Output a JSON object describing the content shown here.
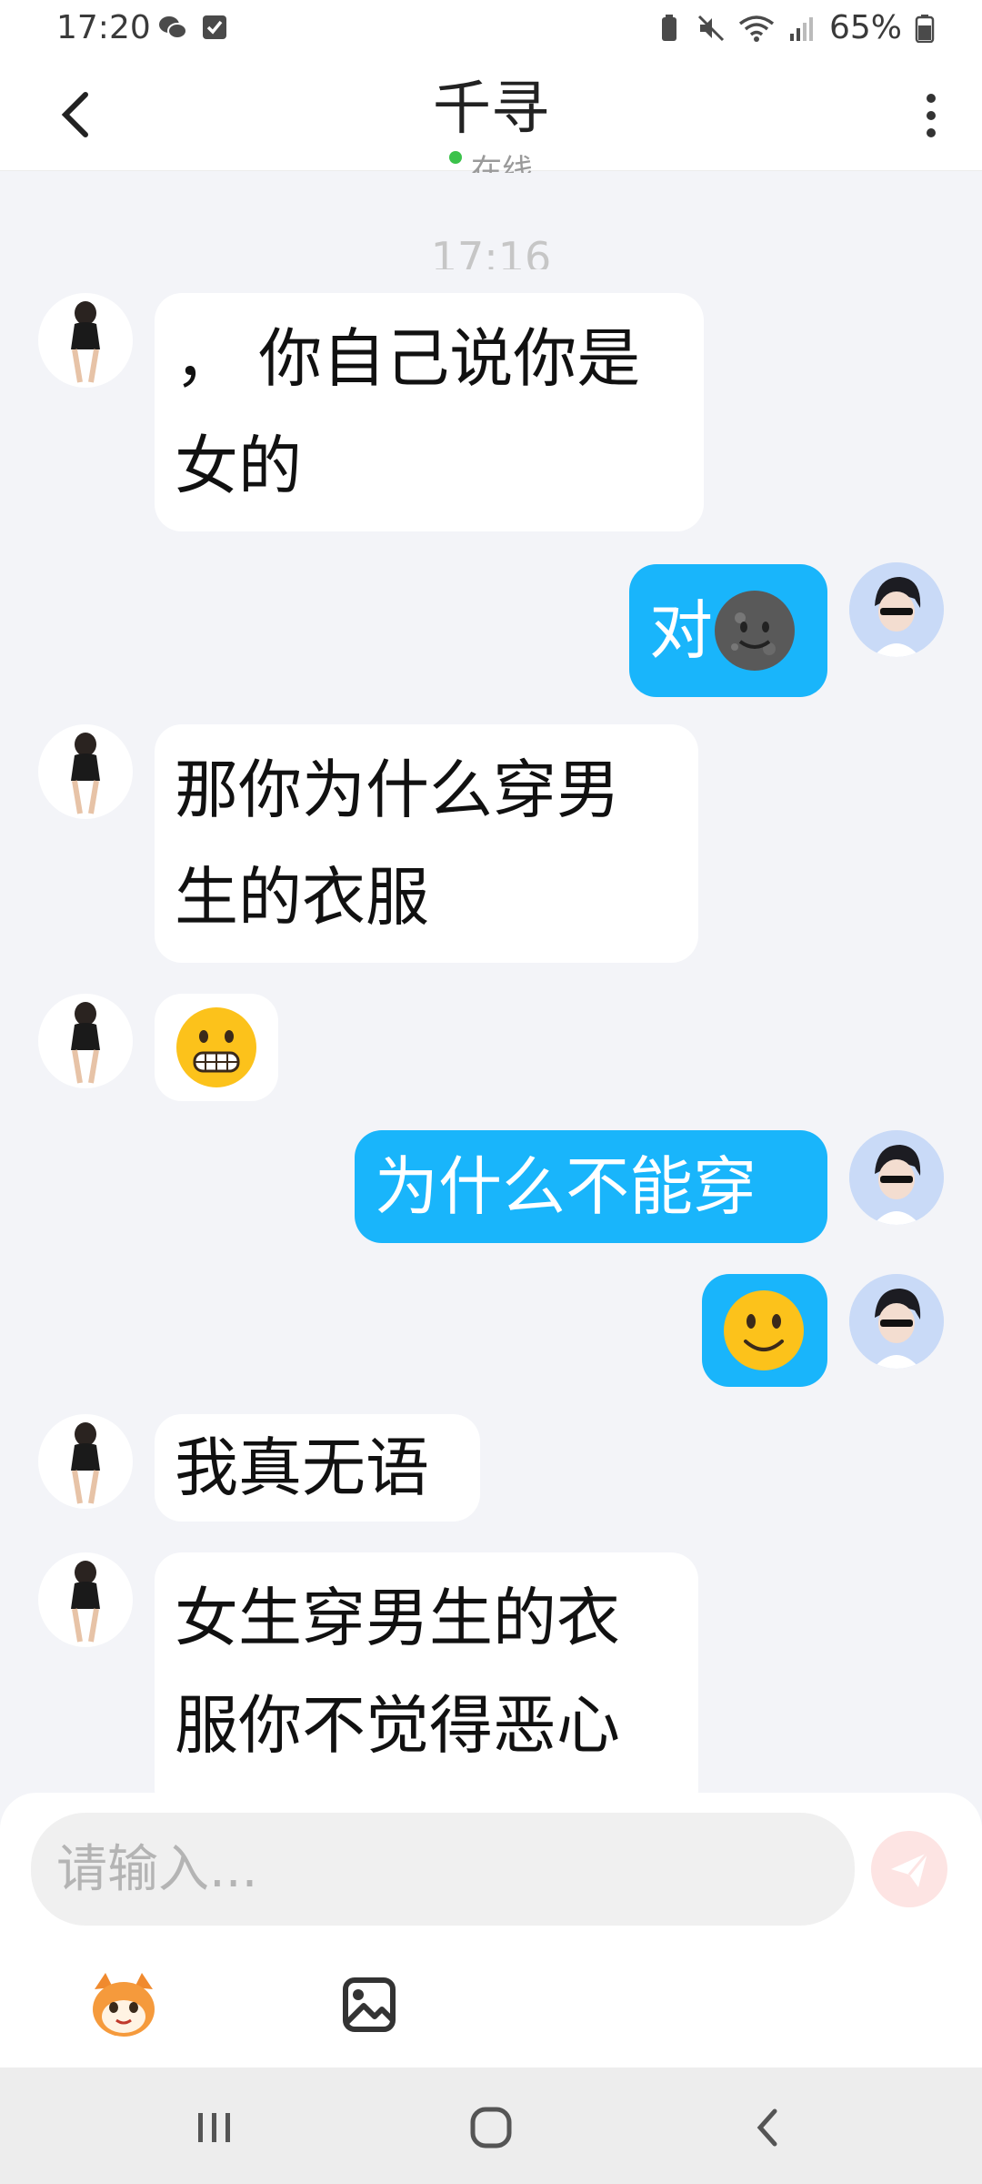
{
  "status": {
    "time": "17:20",
    "battery": "65%"
  },
  "header": {
    "title": "千寻",
    "subtitle": "在线"
  },
  "timestamp": "17:16",
  "messages": [
    {
      "side": "left",
      "line1": "， 你自己说你是",
      "line2": "女的"
    },
    {
      "side": "right",
      "text": "对",
      "emoji": "new-moon-face-emoji"
    },
    {
      "side": "left",
      "line1": "那你为什么穿男",
      "line2": "生的衣服"
    },
    {
      "side": "left",
      "emoji": "grimacing-face-emoji"
    },
    {
      "side": "right",
      "text": "为什么不能穿"
    },
    {
      "side": "right",
      "emoji": "slightly-smiling-face-emoji"
    },
    {
      "side": "left",
      "text": "我真无语"
    },
    {
      "side": "left",
      "line1": "女生穿男生的衣",
      "line2": "服你不觉得恶心"
    }
  ],
  "composer": {
    "placeholder": "请输入..."
  },
  "icons": {
    "back": "chevron-left-icon",
    "more": "vertical-dots-icon",
    "send": "paper-plane-icon",
    "sticker": "mascot-sticker-icon",
    "image": "image-gallery-icon"
  },
  "colors": {
    "bubble_mine": "#19b5fb",
    "bubble_theirs": "#ffffff",
    "background": "#f3f4f8",
    "online": "#3bc24b"
  }
}
